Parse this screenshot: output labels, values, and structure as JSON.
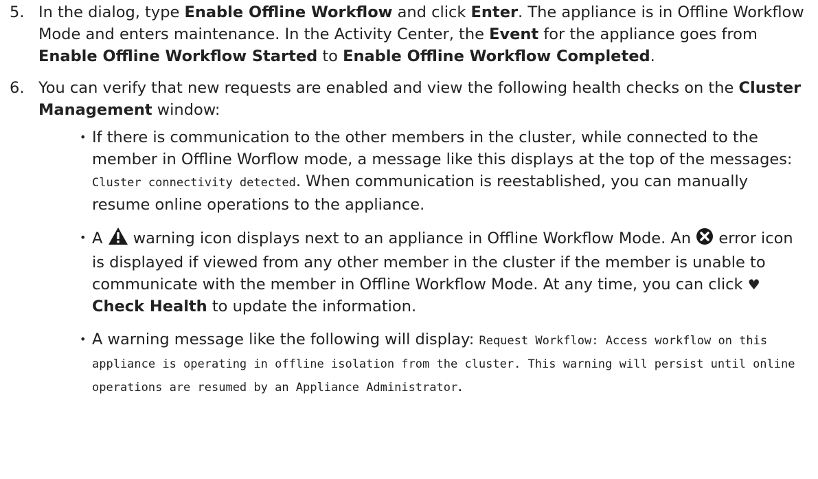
{
  "steps": [
    {
      "number": "5.",
      "p1": "In the dialog, type ",
      "b1": "Enable Offline Workflow",
      "p2": " and click ",
      "b2": "Enter",
      "p3": ". The appliance is in Offline Workflow Mode and enters maintenance. In the Activity Center, the ",
      "b3": "Event",
      "p4": " for the appliance goes from ",
      "b4": "Enable Offline Workflow Started",
      "p5": " to ",
      "b5": "Enable Offline Workflow Completed",
      "p6": "."
    },
    {
      "number": "6.",
      "p1": "You can verify that new requests are enabled and view the following health checks on the ",
      "b1": "Cluster Management",
      "p2": " window:",
      "bullets": [
        {
          "t1": "If there is communication to the other members in the cluster, while connected to the member in Offline Worflow mode, a message like this displays at the top of the messages: ",
          "code": "Cluster connectivity detected",
          "t2": ". When communication is reestablished, you can manually resume online operations to the appliance."
        },
        {
          "t1": "A ",
          "warning_icon": "warning-icon",
          "t2": " warning icon displays next to an appliance in Offline Workflow Mode. An ",
          "error_icon": "error-icon",
          "t3": " error icon is displayed if viewed from any other member in the cluster if the member is unable to communicate with the member in Offline Workflow Mode. At any time, you can click ",
          "heart_icon": "heart-icon",
          "b1": "Check Health",
          "t4": " to update the information."
        },
        {
          "t1": "A warning message like the following will display: ",
          "code": "Request Workflow: Access workflow on this appliance is operating in offline isolation from the cluster. This warning will persist until online operations are resumed by an Appliance Administrator",
          "t2": "."
        }
      ]
    }
  ]
}
